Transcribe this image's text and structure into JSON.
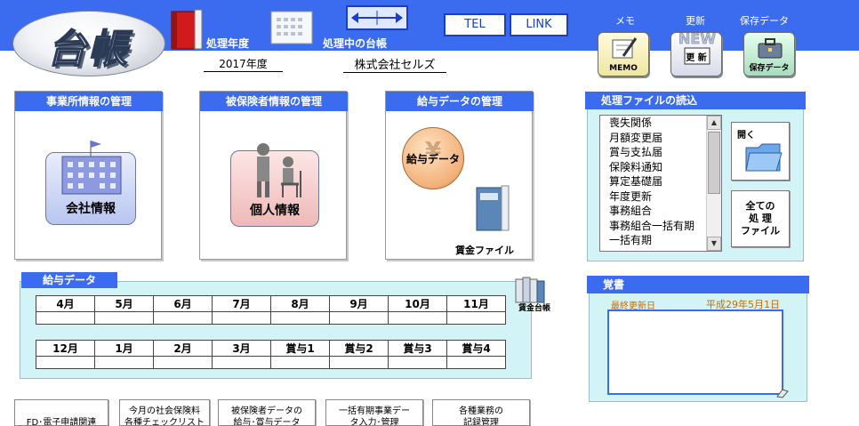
{
  "app": {
    "logo_text": "台帳"
  },
  "header": {
    "shori_nendo_label": "処理年度",
    "shori_daicho_label": "処理中の台帳",
    "year_value": "2017年度",
    "company_value": "株式会社セルズ",
    "tel_label": "TEL",
    "link_label": "LINK",
    "memo_label": "メモ",
    "memo_caption": "MEMO",
    "update_label": "更新",
    "update_badge": "NEW",
    "update_caption": "更 新",
    "save_label": "保存データ",
    "save_caption": "保存データ"
  },
  "panels": {
    "jigyosho": {
      "title": "事業所情報の管理",
      "button": "会社情報"
    },
    "hihokensha": {
      "title": "被保険者情報の管理",
      "button": "個人情報"
    },
    "kyuyo": {
      "title": "給与データの管理",
      "button": "給与データ",
      "file_caption": "賃金ファイル"
    }
  },
  "kyuyo_data": {
    "title": "給与データ",
    "row1": [
      "4月",
      "5月",
      "6月",
      "7月",
      "8月",
      "9月",
      "10月",
      "11月"
    ],
    "row2": [
      "12月",
      "1月",
      "2月",
      "3月",
      "賞与1",
      "賞与2",
      "賞与3",
      "賞与4"
    ],
    "ledger_caption": "賃金台帳"
  },
  "file_reader": {
    "title": "処理ファイルの読込",
    "items": [
      "喪失関係",
      "月額変更届",
      "賞与支払届",
      "保険料通知",
      "算定基礎届",
      "年度更新",
      "事務組合",
      "事務組合一括有期",
      "一括有期"
    ],
    "open_label": "開く",
    "all_files_label": [
      "全ての",
      "処 理",
      "ファイル"
    ]
  },
  "memo": {
    "title": "覚書",
    "last_updated_label": "最終更新日",
    "last_updated_value": "平成29年5月1日"
  },
  "bottom_buttons": [
    {
      "line1": "",
      "line2": "FD･電子申請関連"
    },
    {
      "line1": "今月の社会保険料",
      "line2": "各種チェックリスト"
    },
    {
      "line1": "被保険者データの",
      "line2": "給与･賞与データ"
    },
    {
      "line1": "一括有期事業デー",
      "line2": "タ入力･管理"
    },
    {
      "line1": "各種業務の",
      "line2": "記録管理"
    }
  ],
  "colors": {
    "header_blue": "#3b6cf0",
    "panel_cyan": "#d3f4f6"
  }
}
